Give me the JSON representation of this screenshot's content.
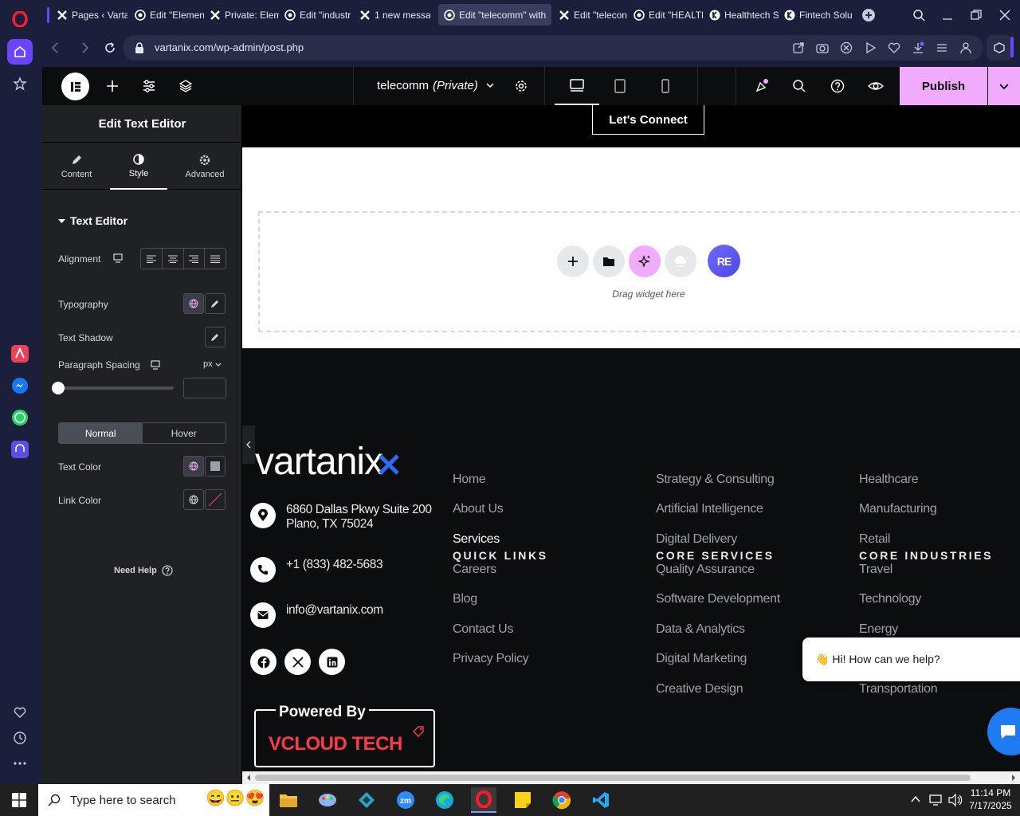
{
  "browser": {
    "tabs": [
      {
        "title": "Pages ‹ Varta",
        "icon": "x-logo-icon"
      },
      {
        "title": "Edit \"Elemen",
        "icon": "wordpress-icon"
      },
      {
        "title": "Private: Elem",
        "icon": "x-logo-icon"
      },
      {
        "title": "Edit \"industr",
        "icon": "wordpress-icon"
      },
      {
        "title": "1 new messa",
        "icon": "x-logo-icon"
      },
      {
        "title": "Edit \"telecomm\" with",
        "icon": "wordpress-icon",
        "active": true
      },
      {
        "title": "Edit \"telecon",
        "icon": "x-logo-icon"
      },
      {
        "title": "Edit \"HEALTH",
        "icon": "wordpress-icon"
      },
      {
        "title": "Healthtech S",
        "icon": "k-logo-icon"
      },
      {
        "title": "Fintech Solu",
        "icon": "k-logo-icon"
      }
    ],
    "url": "vartanix.com/wp-admin/post.php"
  },
  "elementor": {
    "page_title": "telecomm",
    "page_status": "(Private)",
    "publish_label": "Publish",
    "panel_title": "Edit Text Editor",
    "tabs": [
      {
        "label": "Content",
        "icon": "pencil-icon"
      },
      {
        "label": "Style",
        "icon": "contrast-icon",
        "active": true
      },
      {
        "label": "Advanced",
        "icon": "gear-icon"
      }
    ],
    "section_title": "Text Editor",
    "controls": {
      "alignment": "Alignment",
      "typography": "Typography",
      "text_shadow": "Text Shadow",
      "paragraph_spacing": "Paragraph Spacing",
      "unit": "px",
      "paragraph_spacing_value": "",
      "state_normal": "Normal",
      "state_hover": "Hover",
      "text_color": "Text Color",
      "link_color": "Link Color"
    },
    "need_help": "Need Help"
  },
  "canvas": {
    "cta_button": "Let's Connect",
    "drop_hint": "Drag widget here",
    "widget_badge": "RE",
    "footer": {
      "logo": "vartanix",
      "address_line1": "6860 Dallas Pkwy Suite 200",
      "address_line2": "Plano, TX 75024",
      "phone": "+1 (833) 482-5683",
      "email": "info@vartanix.com",
      "quick_links_title": "QUICK LINKS",
      "quick_links": [
        "Home",
        "About Us",
        "Services",
        "Careers",
        "Blog",
        "Contact Us",
        "Privacy Policy"
      ],
      "core_services_title": "CORE SERVICES",
      "core_services": [
        "Strategy & Consulting",
        "Artificial Intelligence",
        "Digital Delivery",
        "Quality Assurance",
        "Software Development",
        "Data & Analytics",
        "Digital Marketing",
        "Creative Design"
      ],
      "core_industries_title": "CORE INDUSTRIES",
      "core_industries": [
        "Healthcare",
        "Manufacturing",
        "Retail",
        "Travel",
        "Technology",
        "Energy",
        "",
        "Transportation"
      ],
      "powered_by": "Powered By",
      "powered_brand": "VCLOUD TECH"
    },
    "chat_bubble": "👋 Hi! How can we help?"
  },
  "taskbar": {
    "search_placeholder": "Type here to search",
    "time": "11:14 PM",
    "date": "7/17/2025"
  },
  "colors": {
    "accent_pink": "#f0abfc",
    "footer_bg": "#0c0d0e",
    "brand_blue": "#2d6bf5",
    "chat_blue": "#1e7bf2"
  }
}
